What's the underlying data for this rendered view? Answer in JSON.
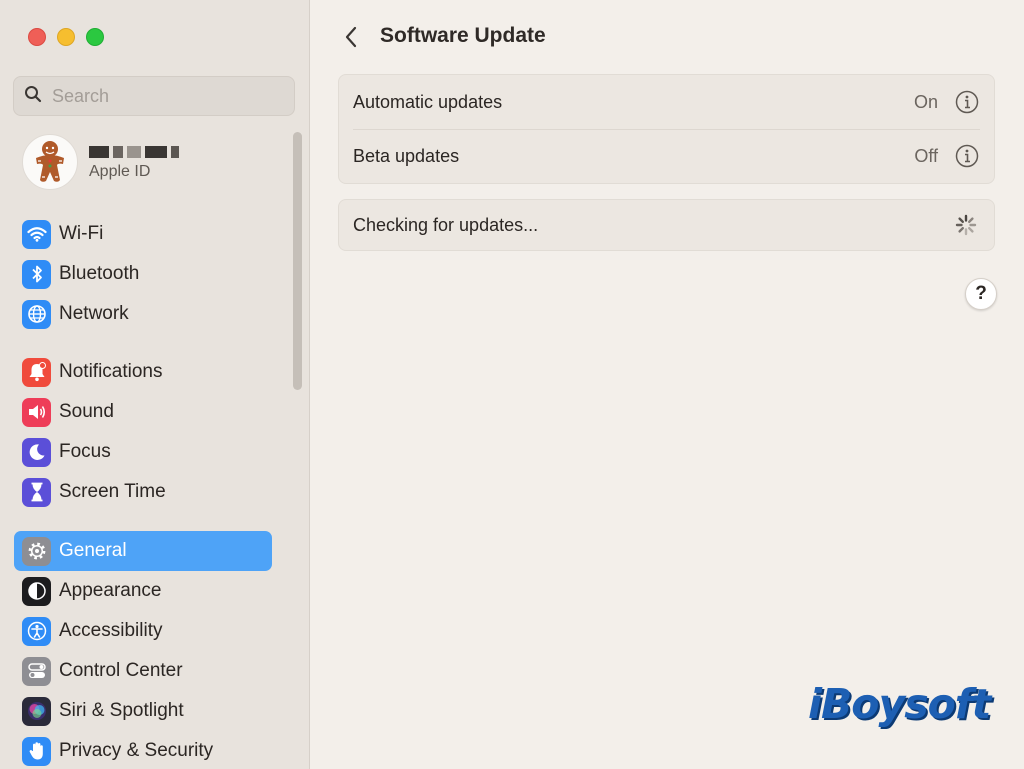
{
  "window": {
    "title": "Software Update"
  },
  "sidebar": {
    "search_placeholder": "Search",
    "account": {
      "subtitle": "Apple ID"
    },
    "groups": [
      [
        {
          "label": "Wi-Fi",
          "icon": "wifi-icon",
          "color": "#2f8cf6"
        },
        {
          "label": "Bluetooth",
          "icon": "bluetooth-icon",
          "color": "#2f8cf6"
        },
        {
          "label": "Network",
          "icon": "globe-icon",
          "color": "#2f8cf6"
        }
      ],
      [
        {
          "label": "Notifications",
          "icon": "bell-icon",
          "color": "#f04b3c"
        },
        {
          "label": "Sound",
          "icon": "speaker-icon",
          "color": "#ee3d58"
        },
        {
          "label": "Focus",
          "icon": "moon-icon",
          "color": "#5b4fd8"
        },
        {
          "label": "Screen Time",
          "icon": "hourglass-icon",
          "color": "#5b4fd8"
        }
      ],
      [
        {
          "label": "General",
          "icon": "gear-icon",
          "color": "#8e8e93",
          "active": true
        },
        {
          "label": "Appearance",
          "icon": "appearance-icon",
          "color": "#1c1c1e"
        },
        {
          "label": "Accessibility",
          "icon": "accessibility-icon",
          "color": "#2f8cf6"
        },
        {
          "label": "Control Center",
          "icon": "toggles-icon",
          "color": "#8e8e93"
        },
        {
          "label": "Siri & Spotlight",
          "icon": "siri-icon",
          "color": "#2a2a3a"
        },
        {
          "label": "Privacy & Security",
          "icon": "hand-icon",
          "color": "#2f8cf6"
        }
      ]
    ]
  },
  "main": {
    "title": "Software Update",
    "settings": [
      {
        "label": "Automatic updates",
        "value": "On"
      },
      {
        "label": "Beta updates",
        "value": "Off"
      }
    ],
    "status": {
      "label": "Checking for updates..."
    },
    "help_label": "?"
  },
  "watermark": "iBoysoft",
  "colors": {
    "sidebar_bg": "#e8e3dd",
    "main_bg": "#f3efea",
    "accent": "#4ea3f7"
  }
}
